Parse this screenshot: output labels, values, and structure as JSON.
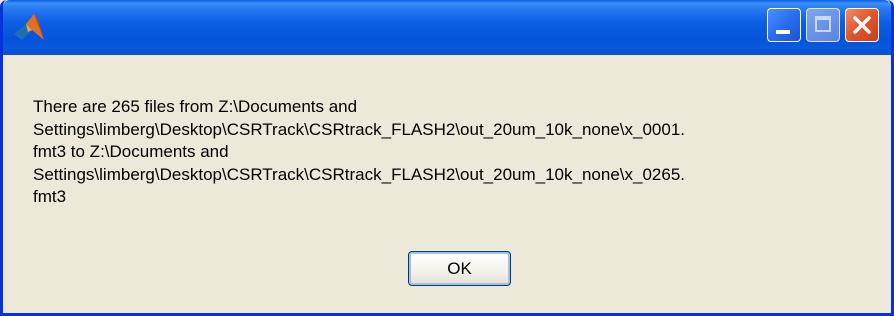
{
  "window": {
    "title": "",
    "controls": {
      "minimize_icon": "minimize-icon",
      "maximize_icon": "maximize-icon",
      "close_icon": "close-icon"
    }
  },
  "dialog": {
    "message": "There are 265 files from Z:\\Documents and\nSettings\\limberg\\Desktop\\CSRTrack\\CSRtrack_FLASH2\\out_20um_10k_none\\x_0001.\nfmt3 to Z:\\Documents and\nSettings\\limberg\\Desktop\\CSRTrack\\CSRtrack_FLASH2\\out_20um_10k_none\\x_0265.\nfmt3",
    "ok_label": "OK"
  },
  "colors": {
    "titlebar": "#0a5fe6",
    "window_border": "#0831d9",
    "dialog_background": "#ece9d8",
    "close_button": "#e0542c"
  }
}
